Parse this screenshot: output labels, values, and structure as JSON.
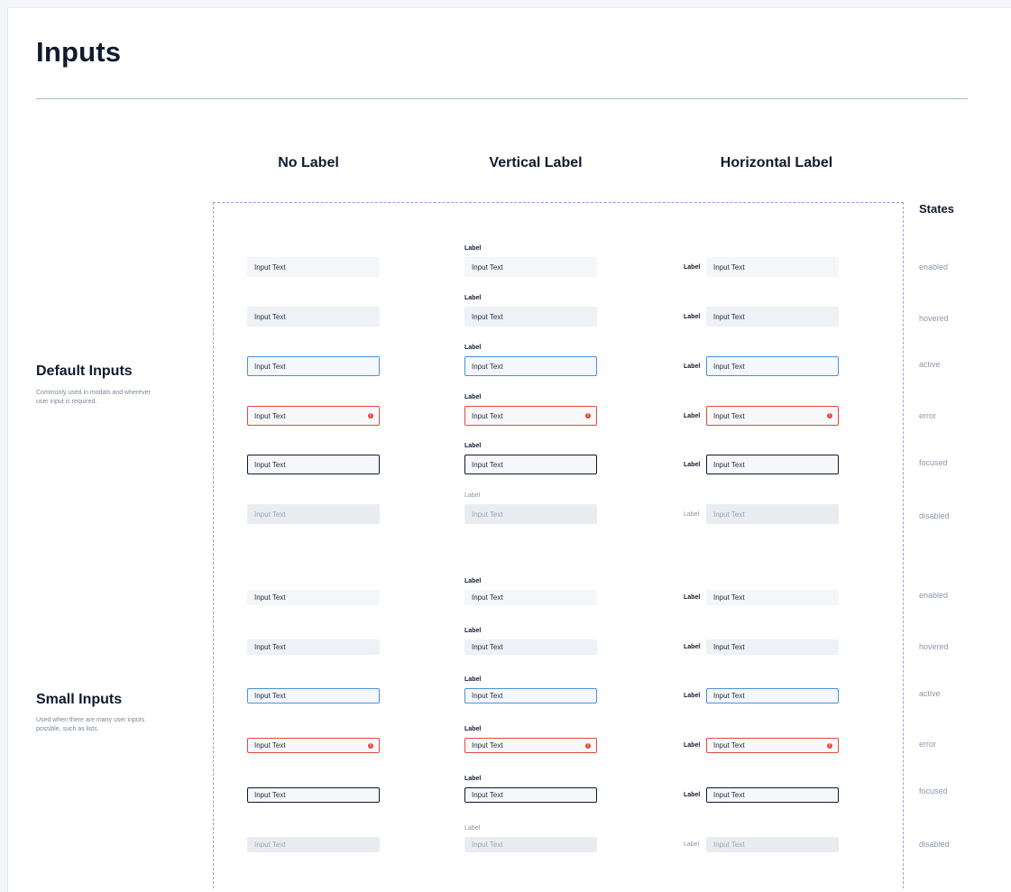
{
  "page": {
    "title": "Inputs"
  },
  "columns": {
    "no_label": "No Label",
    "vertical_label": "Vertical Label",
    "horizontal_label": "Horizontal Label",
    "states": "States"
  },
  "sections": [
    {
      "title": "Default Inputs",
      "description": "Commonly used in modals and wherever user input is required."
    },
    {
      "title": "Small Inputs",
      "description": "Used when there are many user inputs possible, such as lists."
    }
  ],
  "field": {
    "label": "Label",
    "value": "Input Text"
  },
  "states": [
    "enabled",
    "hovered",
    "active",
    "error",
    "focused",
    "disabled"
  ],
  "colors": {
    "active_border": "#4a90e2",
    "error_border": "#e5483b",
    "focused_border": "#0f1a2e",
    "dashed_guide": "#9a9cf0"
  },
  "icons": {
    "error": "error-circle-icon"
  }
}
